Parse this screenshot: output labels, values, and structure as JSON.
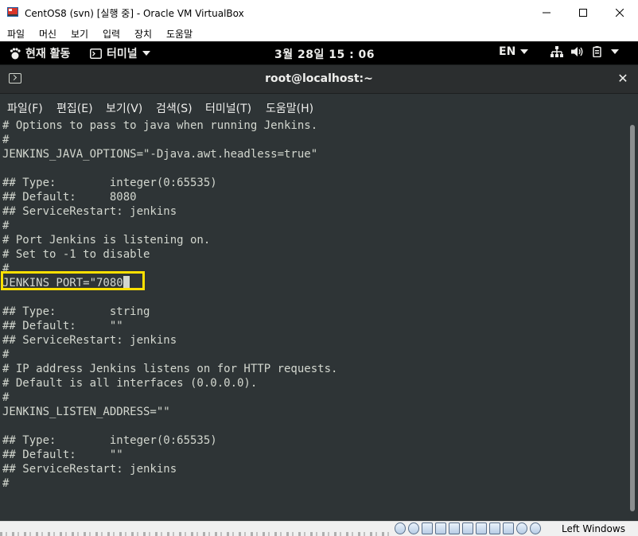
{
  "window": {
    "title": "CentOS8 (svn) [실행 중] - Oracle VM VirtualBox"
  },
  "vbox_menu": [
    "파일",
    "머신",
    "보기",
    "입력",
    "장치",
    "도움말"
  ],
  "gnome": {
    "activities": "현재 활동",
    "app_name": "터미널",
    "clock": "3월 28일  15 : 06",
    "lang": "EN"
  },
  "terminal": {
    "title": "root@localhost:~",
    "menu": [
      "파일(F)",
      "편집(E)",
      "보기(V)",
      "검색(S)",
      "터미널(T)",
      "도움말(H)"
    ],
    "lines": [
      "# Options to pass to java when running Jenkins.",
      "#",
      "JENKINS_JAVA_OPTIONS=\"-Djava.awt.headless=true\"",
      "",
      "## Type:        integer(0:65535)",
      "## Default:     8080",
      "## ServiceRestart: jenkins",
      "#",
      "# Port Jenkins is listening on.",
      "# Set to -1 to disable",
      "#",
      "JENKINS_PORT=\"7080",
      "",
      "## Type:        string",
      "## Default:     \"\"",
      "## ServiceRestart: jenkins",
      "#",
      "# IP address Jenkins listens on for HTTP requests.",
      "# Default is all interfaces (0.0.0.0).",
      "#",
      "JENKINS_LISTEN_ADDRESS=\"\"",
      "",
      "## Type:        integer(0:65535)",
      "## Default:     \"\"",
      "## ServiceRestart: jenkins",
      "#"
    ],
    "cursor_char": "\""
  },
  "status": {
    "host_key": "Left Windows"
  },
  "colors": {
    "terminal_bg": "#2e3436",
    "terminal_fg": "#d3d7cf",
    "highlight": "#ffe000"
  }
}
